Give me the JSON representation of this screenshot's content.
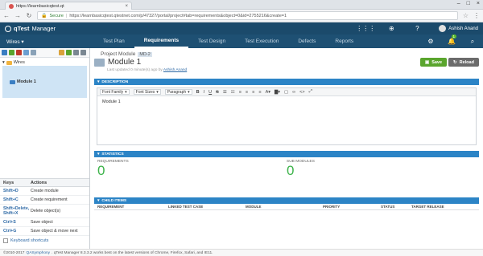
{
  "browser": {
    "tab_title": "https://learnbasicqtest.qt",
    "url_secure": "Secure",
    "url": "https://learnbasicqtest.qtestnet.com/p/47327/portal/project#tab=requirements&object=0&id=2755216&create=1"
  },
  "app": {
    "brand_q": "qTest",
    "brand_name": "Manager",
    "user_name": "Ashish Anand",
    "project": "Wires",
    "notification_count": "1",
    "tabs": [
      {
        "label": "Test Plan"
      },
      {
        "label": "Requirements"
      },
      {
        "label": "Test Design"
      },
      {
        "label": "Test Execution"
      },
      {
        "label": "Defects"
      },
      {
        "label": "Reports"
      }
    ]
  },
  "tree": {
    "root": "Wires",
    "child": "Module 1"
  },
  "shortcuts": {
    "head_keys": "Keys",
    "head_actions": "Actions",
    "rows": [
      {
        "key": "Shift+D",
        "action": "Create module"
      },
      {
        "key": "Shift+C",
        "action": "Create requirement"
      },
      {
        "key": "Shift+Delete, Shift+X",
        "action": "Delete object(s)"
      },
      {
        "key": "Ctrl+S",
        "action": "Save object"
      },
      {
        "key": "Ctrl+G",
        "action": "Save object & move next"
      }
    ],
    "link": "Keyboard shortcuts"
  },
  "main": {
    "crumb_label": "Project Module",
    "crumb_id": "MD-2",
    "title": "Module 1",
    "last_updated": "Last updated 0 minute(s) ago by",
    "last_updated_by": "Ashish Anand",
    "save": "Save",
    "reload": "Reload"
  },
  "description": {
    "header": "DESCRIPTION",
    "font_family": "Font Family",
    "font_sizes": "Font Sizes",
    "paragraph": "Paragraph",
    "body": "Module 1"
  },
  "statistics": {
    "header": "STATISTICS",
    "requirements_label": "REQUIREMENTS",
    "requirements_value": "0",
    "submodules_label": "SUB MODULES",
    "submodules_value": "0"
  },
  "child_items": {
    "header": "CHILD ITEMS",
    "columns": [
      "REQUIREMENT",
      "LINKED TEST CASE",
      "MODULE",
      "PRIORITY",
      "STATUS",
      "TARGET RELEASE"
    ]
  },
  "footer": {
    "copyright": "©2010-2017",
    "company": "QASymphony",
    "text": ". qTest Manager 8.3.3.2 works best on the latest versions of Chrome, Firefox, Safari, and IE11."
  }
}
